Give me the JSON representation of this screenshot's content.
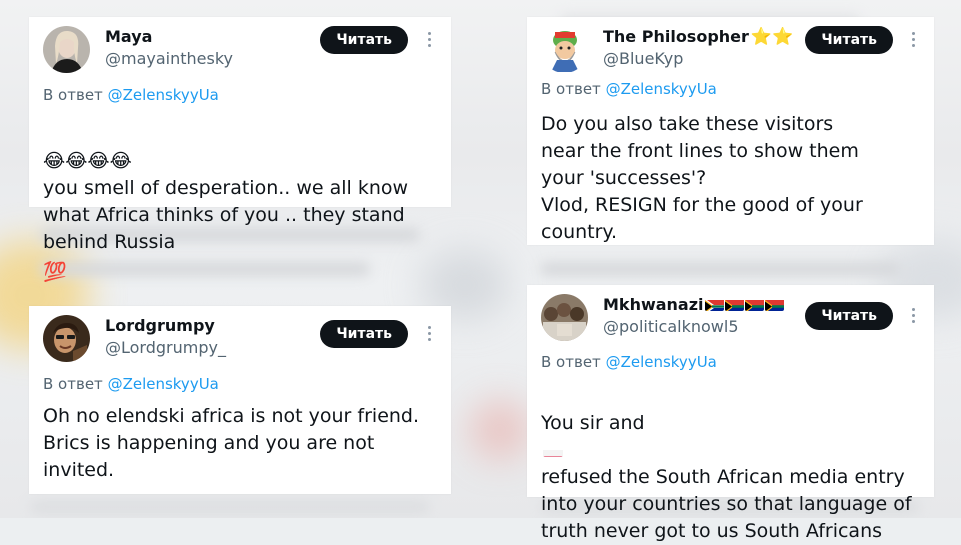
{
  "colors": {
    "follow_bg": "#0f1419",
    "mention": "#1d9bf0",
    "muted": "#536471",
    "text": "#0f1419"
  },
  "tweets": [
    {
      "name": "Maya",
      "handle": "@mayainthesky",
      "follow_label": "Читать",
      "reply_prefix": "В ответ",
      "reply_to": "@ZelenskyyUa",
      "emoji_prefix": "😂😂😂😂",
      "text_main": "you smell of desperation.. we all know what Africa thinks of you .. they stand behind Russia",
      "emoji_suffix": "💯",
      "avatar_icon": "woman-avatar"
    },
    {
      "name": "The Philosopher",
      "name_suffix": "⭐⭐",
      "handle": "@BlueKyp",
      "follow_label": "Читать",
      "reply_prefix": "В ответ",
      "reply_to": "@ZelenskyyUa",
      "text_main": "Do you also take these visitors near the front lines to show them your 'successes'?\nVlod, RESIGN for the good of your country.",
      "avatar_icon": "cartoon-avatar"
    },
    {
      "name": "Lordgrumpy",
      "handle": "@Lordgrumpy_",
      "follow_label": "Читать",
      "reply_prefix": "В ответ",
      "reply_to": "@ZelenskyyUa",
      "text_main": "Oh no elendski africa is not your friend.\nBrics is happening and you are not invited.",
      "avatar_icon": "man-avatar"
    },
    {
      "name": "Mkhwanazi",
      "name_flags": "🇿🇦🇿🇦🇿🇦🇿🇦",
      "handle": "@politicalknowl5",
      "follow_label": "Читать",
      "reply_prefix": "В ответ",
      "reply_to": "@ZelenskyyUa",
      "text_before_flag": "You sir and",
      "text_after_flag": "refused the South African media entry into your countries so that language of truth never got to us South Africans",
      "avatar_icon": "group-avatar"
    }
  ]
}
